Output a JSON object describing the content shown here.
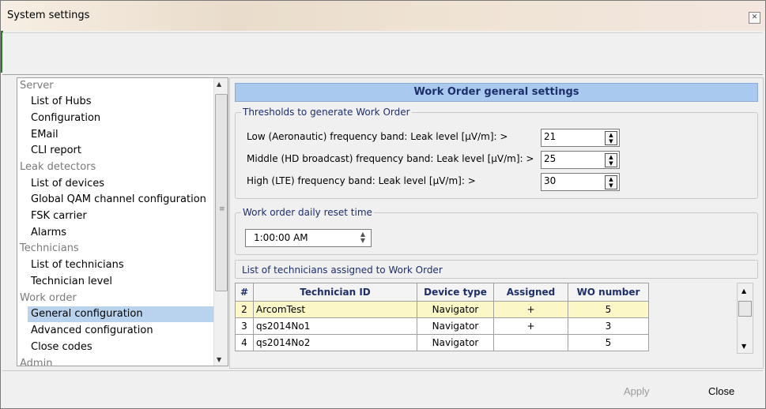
{
  "window": {
    "title": "System settings"
  },
  "tree": {
    "categories": [
      {
        "label": "Server",
        "items": [
          "List of Hubs",
          "Configuration",
          "EMail",
          "CLI report"
        ]
      },
      {
        "label": "Leak detectors",
        "items": [
          "List of devices",
          "Global QAM channel configuration",
          "FSK carrier",
          "Alarms"
        ]
      },
      {
        "label": "Technicians",
        "items": [
          "List of technicians",
          "Technician level"
        ]
      },
      {
        "label": "Work order",
        "items": [
          "General configuration",
          "Advanced configuration",
          "Close codes"
        ]
      },
      {
        "label": "Admin",
        "items": []
      }
    ],
    "selected": "General configuration"
  },
  "panel": {
    "header": "Work Order general settings",
    "thresholds": {
      "legend": "Thresholds to generate Work Order",
      "rows": [
        {
          "label": "Low (Aeronautic) frequency band: Leak level [µV/m]: >",
          "value": "21"
        },
        {
          "label": "Middle (HD broadcast) frequency band: Leak level [µV/m]: >",
          "value": "25"
        },
        {
          "label": "High (LTE) frequency band: Leak level [µV/m]: >",
          "value": "30"
        }
      ]
    },
    "reset": {
      "legend": "Work order daily reset time",
      "value": "1:00:00 AM"
    },
    "list": {
      "title": "List of technicians assigned to Work Order",
      "columns": [
        "#",
        "Technician ID",
        "Device type",
        "Assigned",
        "WO number"
      ],
      "rows": [
        {
          "num": "2",
          "id": "ArcomTest",
          "device": "Navigator",
          "assigned": "+",
          "wo": "5"
        },
        {
          "num": "3",
          "id": "qs2014No1",
          "device": "Navigator",
          "assigned": "+",
          "wo": "3"
        },
        {
          "num": "4",
          "id": "qs2014No2",
          "device": "Navigator",
          "assigned": "",
          "wo": "5"
        }
      ]
    }
  },
  "footer": {
    "apply_label": "Apply",
    "close_label": "Close"
  },
  "icons": {
    "close": "close-icon",
    "scroll_up": "arrow-up-icon",
    "scroll_down": "arrow-down-icon"
  },
  "colors": {
    "header_bg": "#a9c9ef",
    "selected_bg": "#b9d3ee",
    "highlight_row": "#fcf7c7"
  }
}
